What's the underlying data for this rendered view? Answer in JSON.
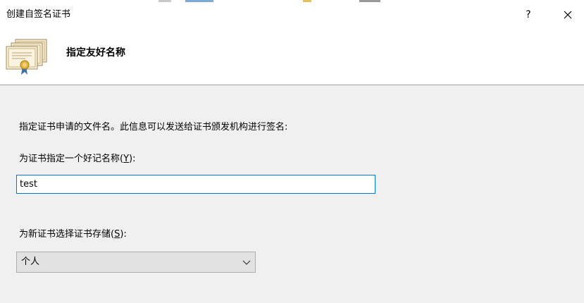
{
  "window": {
    "title": "创建自签名证书",
    "help_label": "?"
  },
  "header": {
    "title": "指定友好名称",
    "icon": "certificate-icon"
  },
  "form": {
    "description": "指定证书申请的文件名。此信息可以发送给证书颁发机构进行签名:",
    "friendly_name_label": "为证书指定一个好记名称",
    "friendly_name_access_key": "Y",
    "friendly_name_value": "test",
    "store_label": "为新证书选择证书存储",
    "store_access_key": "S",
    "store_selected": "个人"
  },
  "colors": {
    "focus_border": "#0078d7",
    "dialog_bg": "#f0f0f0"
  }
}
